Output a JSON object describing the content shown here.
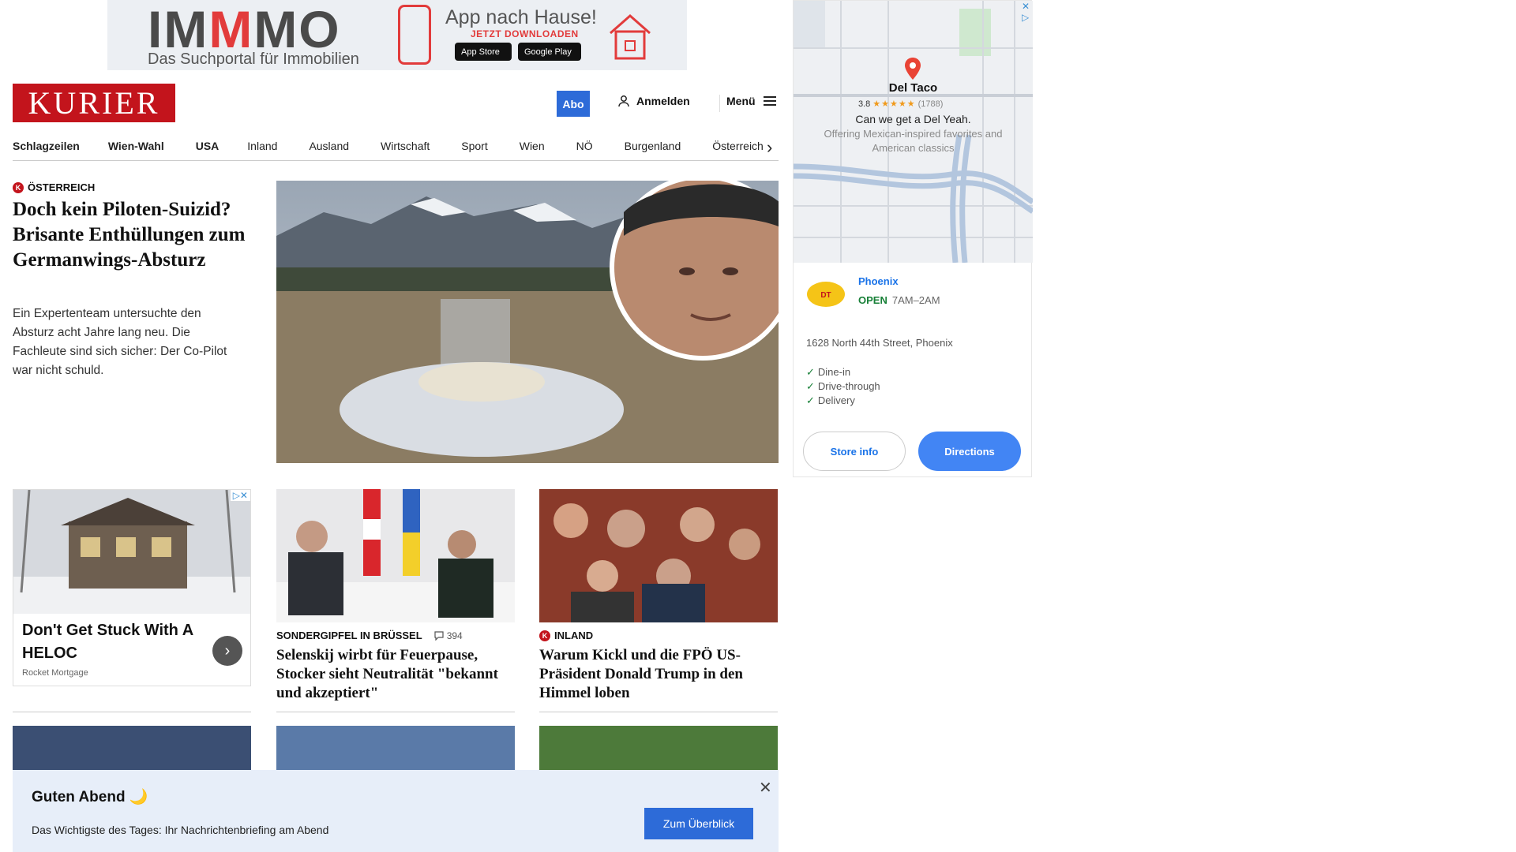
{
  "top_ad": {
    "brand_left": "IM",
    "brand_red": "M",
    "brand_right": "MO",
    "brand_sub": "Das Suchportal für Immobilien",
    "app_title": "App nach Hause!",
    "app_sub": "JETZT DOWNLOADEN",
    "apple_label": "App Store",
    "google_label": "Google Play"
  },
  "header": {
    "logo": "KURIER",
    "abo": "Abo",
    "login": "Anmelden",
    "menu": "Menü"
  },
  "nav": [
    "Schlagzeilen",
    "Wien-Wahl",
    "USA",
    "Inland",
    "Ausland",
    "Wirtschaft",
    "Sport",
    "Wien",
    "NÖ",
    "Burgenland",
    "Österreich"
  ],
  "lead": {
    "kicker": "ÖSTERREICH",
    "title": "Doch kein Piloten-Suizid? Brisante Enthüllungen zum Germanwings-Absturz",
    "desc": "Ein Expertenteam untersuchte den Absturz acht Jahre lang neu. Die Fachleute sind sich sicher: Der Co-Pilot war nicht schuld."
  },
  "ad_card": {
    "title": "Don't Get Stuck With A HELOC",
    "source": "Rocket Mortgage"
  },
  "cards": [
    {
      "kicker": "SONDERGIPFEL IN BRÜSSEL",
      "comments": "394",
      "title": "Selenskij wirbt für Feuerpause, Stocker sieht Neutralität \"bekannt und akzeptiert\""
    },
    {
      "kicker": "INLAND",
      "title": "Warum Kickl und die FPÖ US-Präsident Donald Trump in den Himmel loben"
    }
  ],
  "briefing": {
    "title": "Guten Abend 🌙",
    "text": "Das Wichtigste des Tages: Ihr Nachrichtenbriefing am Abend",
    "button": "Zum Überblick",
    "close": "✕"
  },
  "map_ad": {
    "place": "Del Taco",
    "rating": "3.8",
    "stars": "★★★★★",
    "rating_count": "(1788)",
    "tagline": "Can we get a Del Yeah.",
    "description": "Offering Mexican-inspired favorites and American classics",
    "city": "Phoenix",
    "open_label": "OPEN",
    "hours": "7AM–2AM",
    "address": "1628 North 44th Street, Phoenix",
    "features": [
      "Dine-in",
      "Drive-through",
      "Delivery"
    ],
    "store_info_btn": "Store info",
    "directions_btn": "Directions"
  },
  "colors": {
    "brand_red": "#c3141c",
    "accent_blue": "#2d6bd8",
    "map_blue": "#4285f4"
  }
}
